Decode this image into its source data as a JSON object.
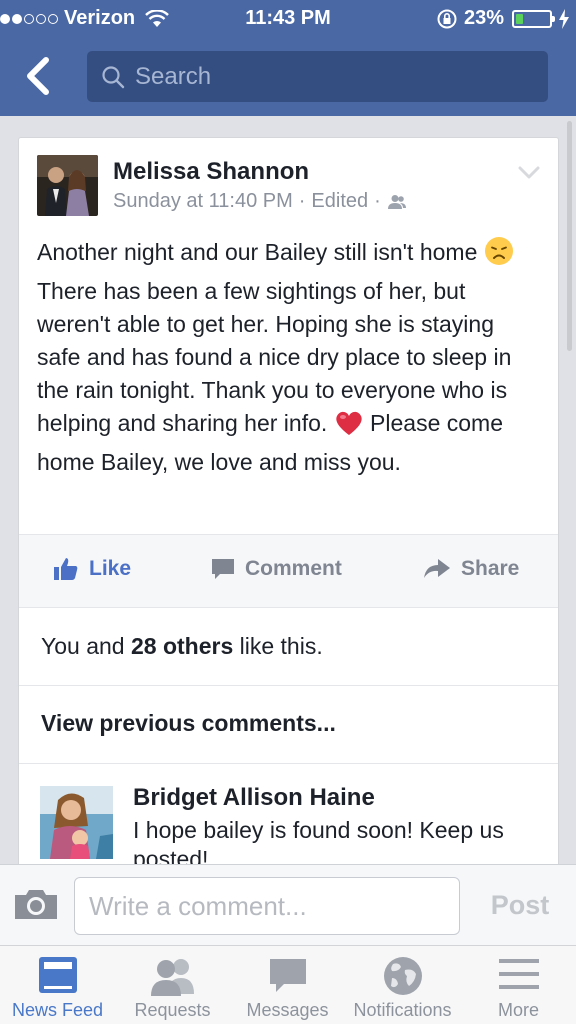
{
  "status_bar": {
    "carrier": "Verizon",
    "time": "11:43 PM",
    "battery": "23%",
    "battery_level": 0.23
  },
  "search": {
    "placeholder": "Search"
  },
  "post": {
    "author": "Melissa Shannon",
    "timestamp": "Sunday at 11:40 PM",
    "edited": "Edited",
    "text_1": "Another night and our Bailey still isn't home",
    "text_2": "There has been a few sightings of her, but weren't able to get her. Hoping she is staying safe and has found a nice dry place to sleep in the rain tonight. Thank you to everyone who is helping and sharing her info.",
    "text_3": "Please come home Bailey, we love and miss you.",
    "actions": {
      "like": "Like",
      "comment": "Comment",
      "share": "Share"
    },
    "likes_prefix": "You and",
    "likes_count": "28 others",
    "likes_suffix": "like this.",
    "view_previous": "View previous comments..."
  },
  "comment": {
    "author": "Bridget Allison Haine",
    "text": "I hope bailey is found soon! Keep us posted!"
  },
  "composer": {
    "placeholder": "Write a comment...",
    "post_label": "Post"
  },
  "tabbar": {
    "items": [
      {
        "label": "News Feed",
        "icon": "news-feed-icon",
        "active": true
      },
      {
        "label": "Requests",
        "icon": "requests-icon"
      },
      {
        "label": "Messages",
        "icon": "messages-icon"
      },
      {
        "label": "Notifications",
        "icon": "globe-icon"
      },
      {
        "label": "More",
        "icon": "menu-icon"
      }
    ]
  },
  "colors": {
    "header": "#4a68a4",
    "search_box": "#344e82",
    "link_blue": "#4b70c6",
    "battery_green": "#5ad15a"
  }
}
